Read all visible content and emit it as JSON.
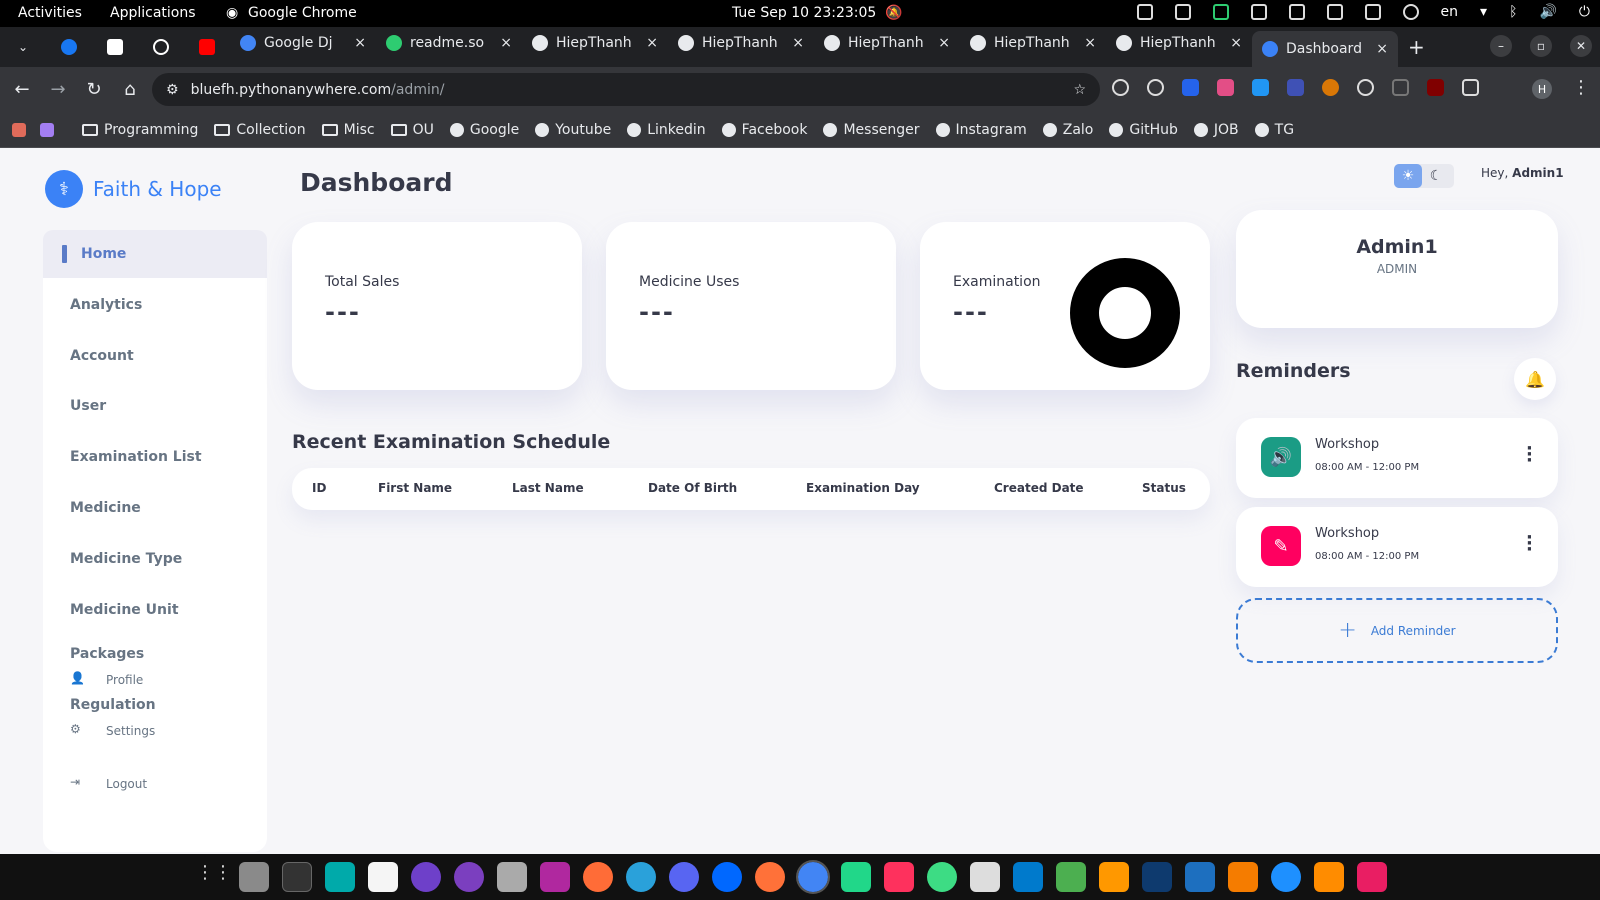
{
  "system": {
    "activities": "Activities",
    "applications": "Applications",
    "active_app": "Google Chrome",
    "datetime": "Tue Sep 10  23:23:05",
    "lang": "en"
  },
  "browser": {
    "tabs": [
      {
        "title": "Google Dj",
        "color": "#4285f4"
      },
      {
        "title": "readme.so",
        "color": "#2ecc71"
      },
      {
        "title": "HiepThanh",
        "color": "#e8eaed"
      },
      {
        "title": "HiepThanh",
        "color": "#e8eaed"
      },
      {
        "title": "HiepThanh",
        "color": "#e8eaed"
      },
      {
        "title": "HiepThanh",
        "color": "#e8eaed"
      },
      {
        "title": "HiepThanh",
        "color": "#e8eaed"
      },
      {
        "title": "Dashboard",
        "color": "#3b82f6"
      }
    ],
    "tab_close": "×",
    "new_tab": "+",
    "url_host": "bluefh.pythonanywhere.com",
    "url_path": "/admin/",
    "profile_initial": "H",
    "bookmarks": [
      "Programming",
      "Collection",
      "Misc",
      "OU",
      "Google",
      "Youtube",
      "Linkedin",
      "Facebook",
      "Messenger",
      "Instagram",
      "Zalo",
      "GitHub",
      "JOB",
      "TG"
    ]
  },
  "app": {
    "brand": "Faith & Hope",
    "page_title": "Dashboard",
    "greeting_prefix": "Hey,",
    "greeting_user": "Admin1",
    "sidebar": {
      "home": "Home",
      "analytics": "Analytics",
      "account": "Account",
      "user": "User",
      "examination_list": "Examination List",
      "medicine": "Medicine",
      "medicine_type": "Medicine Type",
      "medicine_unit": "Medicine Unit",
      "packages": "Packages",
      "profile": "Profile",
      "regulation": "Regulation",
      "settings": "Settings",
      "logout": "Logout"
    },
    "cards": {
      "total_sales": {
        "label": "Total Sales",
        "value": "---"
      },
      "medicine_uses": {
        "label": "Medicine Uses",
        "value": "---"
      },
      "examination": {
        "label": "Examination",
        "value": "---"
      }
    },
    "schedule": {
      "title": "Recent Examination Schedule",
      "columns": {
        "id": "ID",
        "first_name": "First Name",
        "last_name": "Last Name",
        "dob": "Date Of Birth",
        "exam_day": "Examination Day",
        "created": "Created Date",
        "status": "Status"
      }
    },
    "profile": {
      "name": "Admin1",
      "role": "ADMIN"
    },
    "reminders": {
      "title": "Reminders",
      "items": [
        {
          "title": "Workshop",
          "time": "08:00 AM - 12:00 PM",
          "icon": "volume-icon",
          "color": "#1b9c85"
        },
        {
          "title": "Workshop",
          "time": "08:00 AM - 12:00 PM",
          "icon": "edit-icon",
          "color": "#ff0060"
        }
      ],
      "add_label": "Add Reminder"
    }
  }
}
